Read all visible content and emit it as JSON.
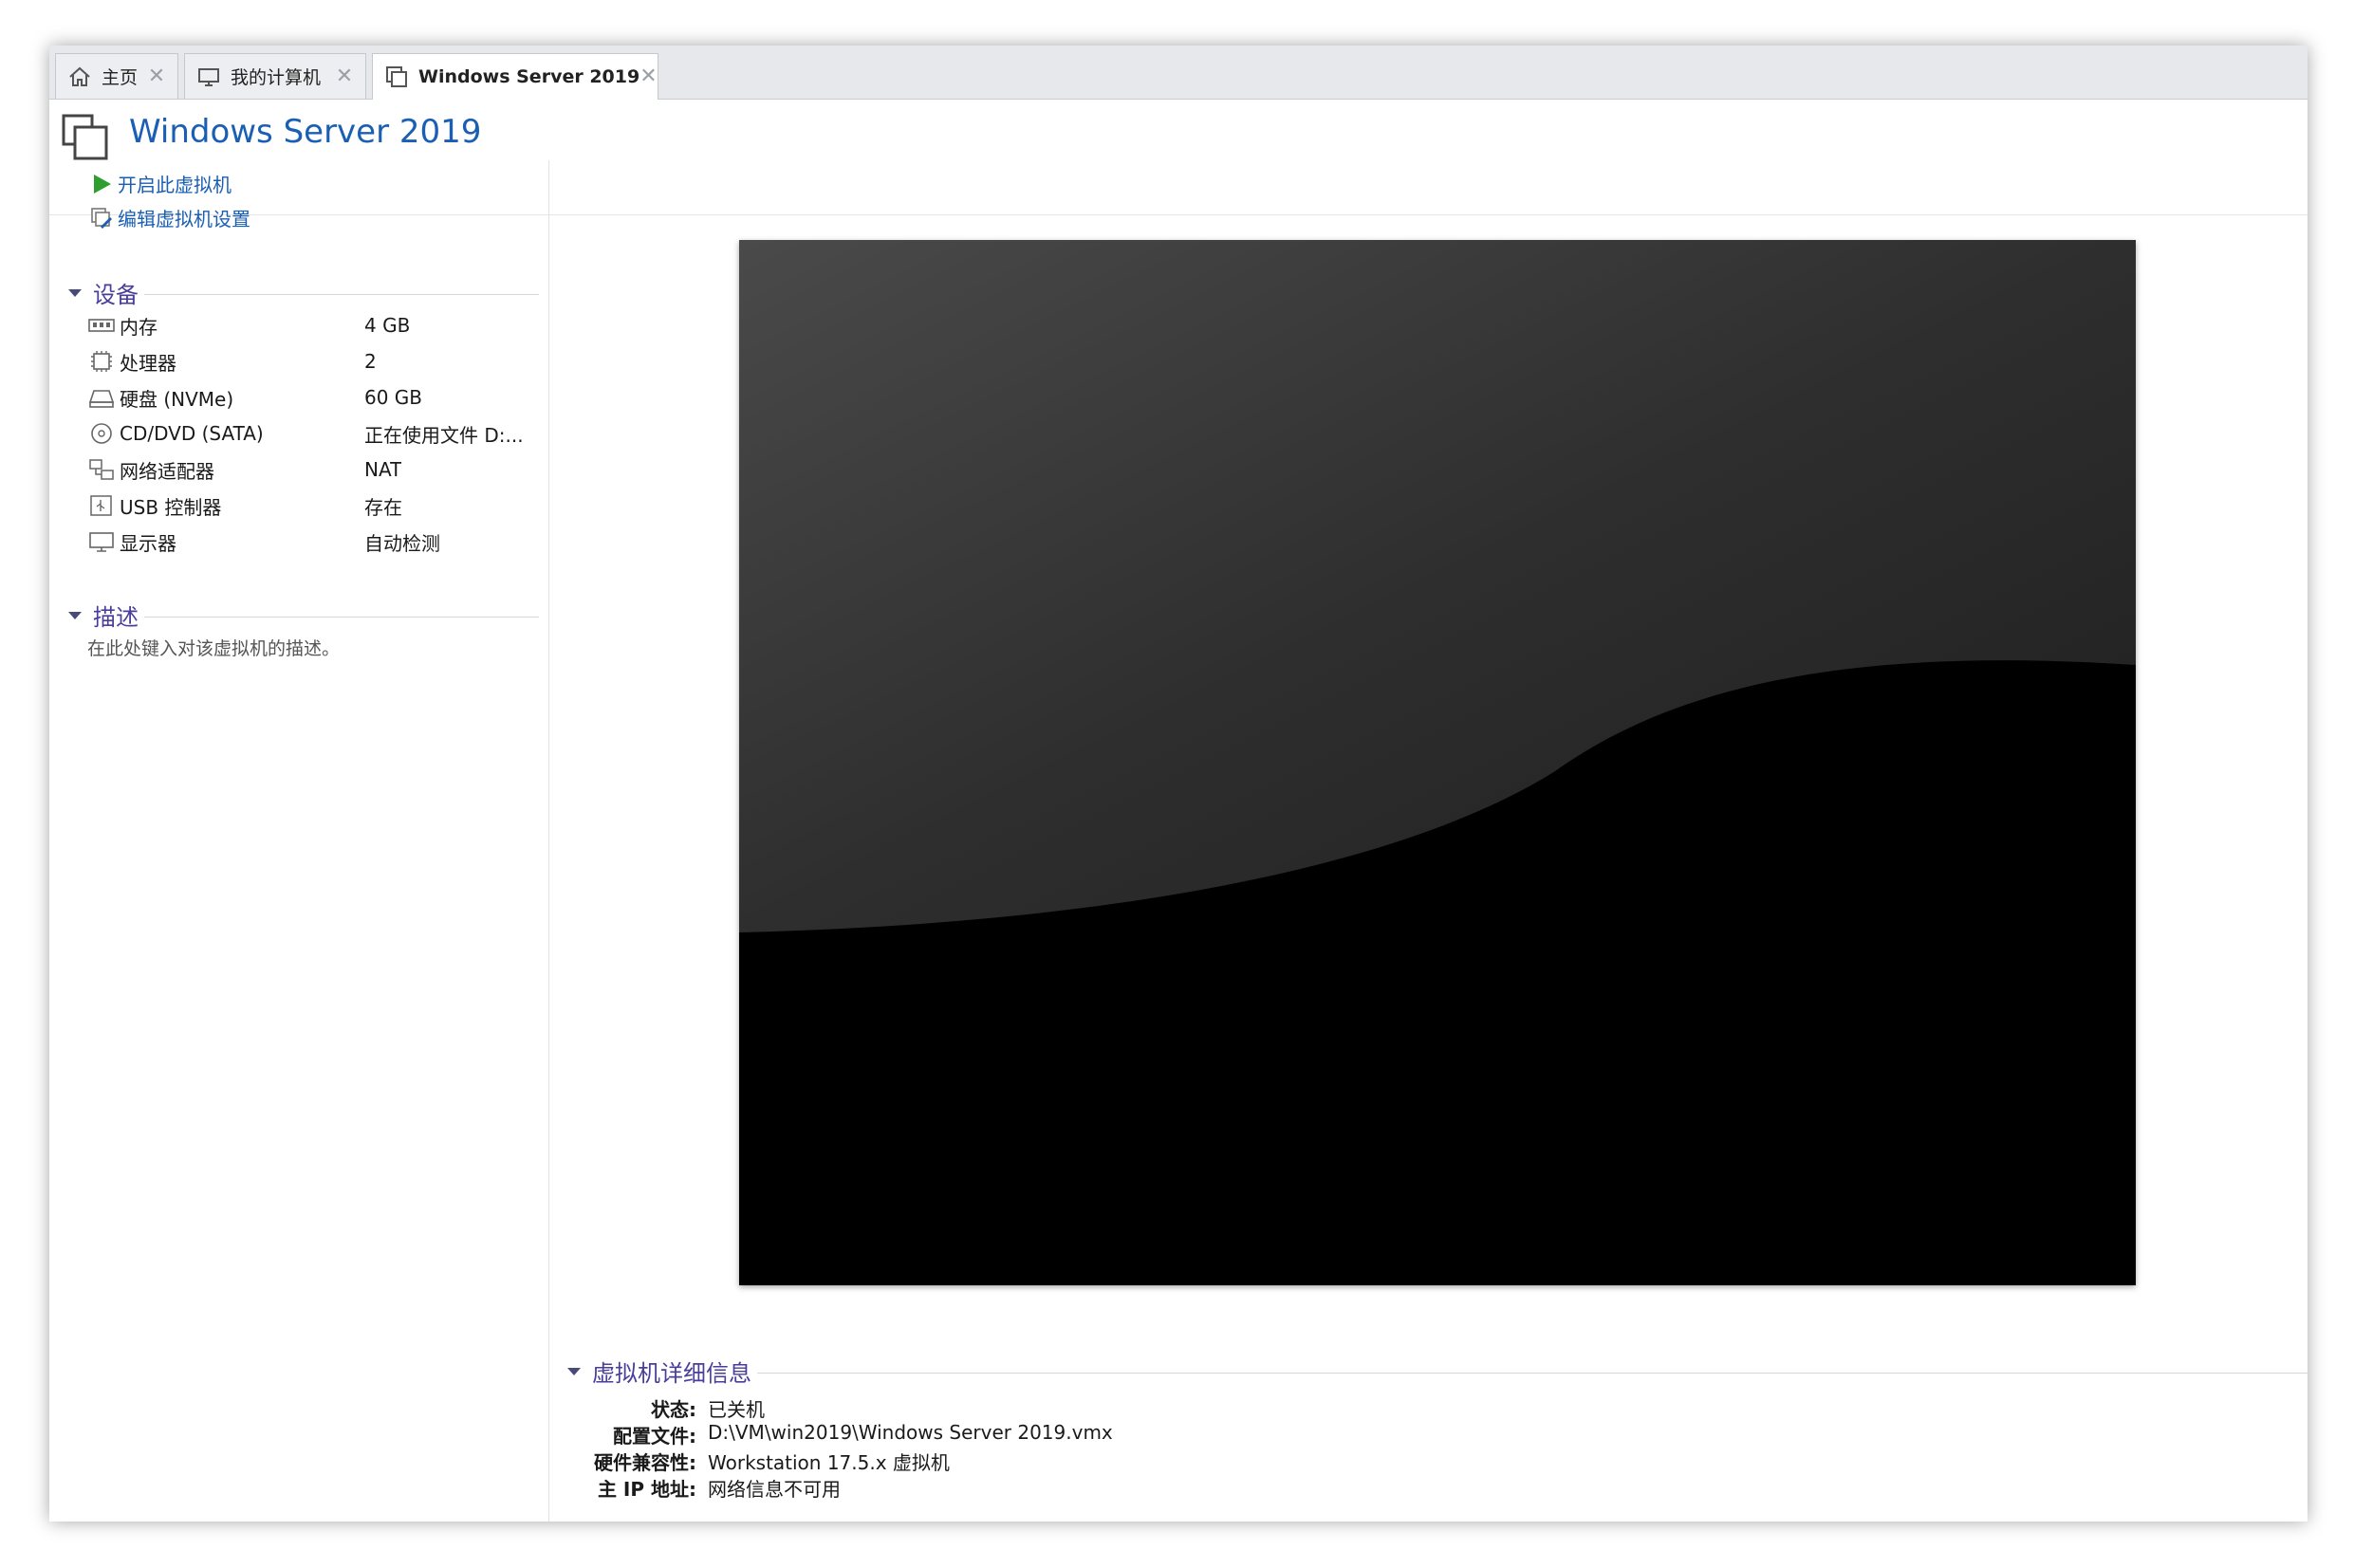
{
  "tabs": [
    {
      "label": "主页",
      "icon": "home-icon",
      "active": false
    },
    {
      "label": "我的计算机",
      "icon": "monitor-icon",
      "active": false
    },
    {
      "label": "Windows Server 2019",
      "icon": "vm-icon",
      "active": true
    }
  ],
  "tab_close_glyph": "✕",
  "header": {
    "title": "Windows Server 2019"
  },
  "actions": {
    "power_on": "开启此虚拟机",
    "edit_settings": "编辑虚拟机设置"
  },
  "devices": {
    "title": "设备",
    "items": [
      {
        "name": "内存",
        "value": "4 GB",
        "icon": "memory-icon"
      },
      {
        "name": "处理器",
        "value": "2",
        "icon": "cpu-icon"
      },
      {
        "name": "硬盘 (NVMe)",
        "value": "60 GB",
        "icon": "hard-disk-icon"
      },
      {
        "name": "CD/DVD (SATA)",
        "value": "正在使用文件 D:...",
        "icon": "cd-dvd-icon"
      },
      {
        "name": "网络适配器",
        "value": "NAT",
        "icon": "network-adapter-icon"
      },
      {
        "name": "USB 控制器",
        "value": "存在",
        "icon": "usb-icon"
      },
      {
        "name": "显示器",
        "value": "自动检测",
        "icon": "display-icon"
      }
    ]
  },
  "description": {
    "title": "描述",
    "placeholder": "在此处键入对该虚拟机的描述。"
  },
  "details": {
    "title": "虚拟机详细信息",
    "rows": [
      {
        "key": "状态:",
        "value": "已关机"
      },
      {
        "key": "配置文件:",
        "value": "D:\\VM\\win2019\\Windows Server 2019.vmx"
      },
      {
        "key": "硬件兼容性:",
        "value": "Workstation 17.5.x 虚拟机"
      },
      {
        "key": "主 IP 地址:",
        "value": "网络信息不可用"
      }
    ]
  },
  "colors": {
    "accent": "#1a5fb4",
    "section_title": "#4a3e9a",
    "play_green": "#2e9e2e"
  }
}
